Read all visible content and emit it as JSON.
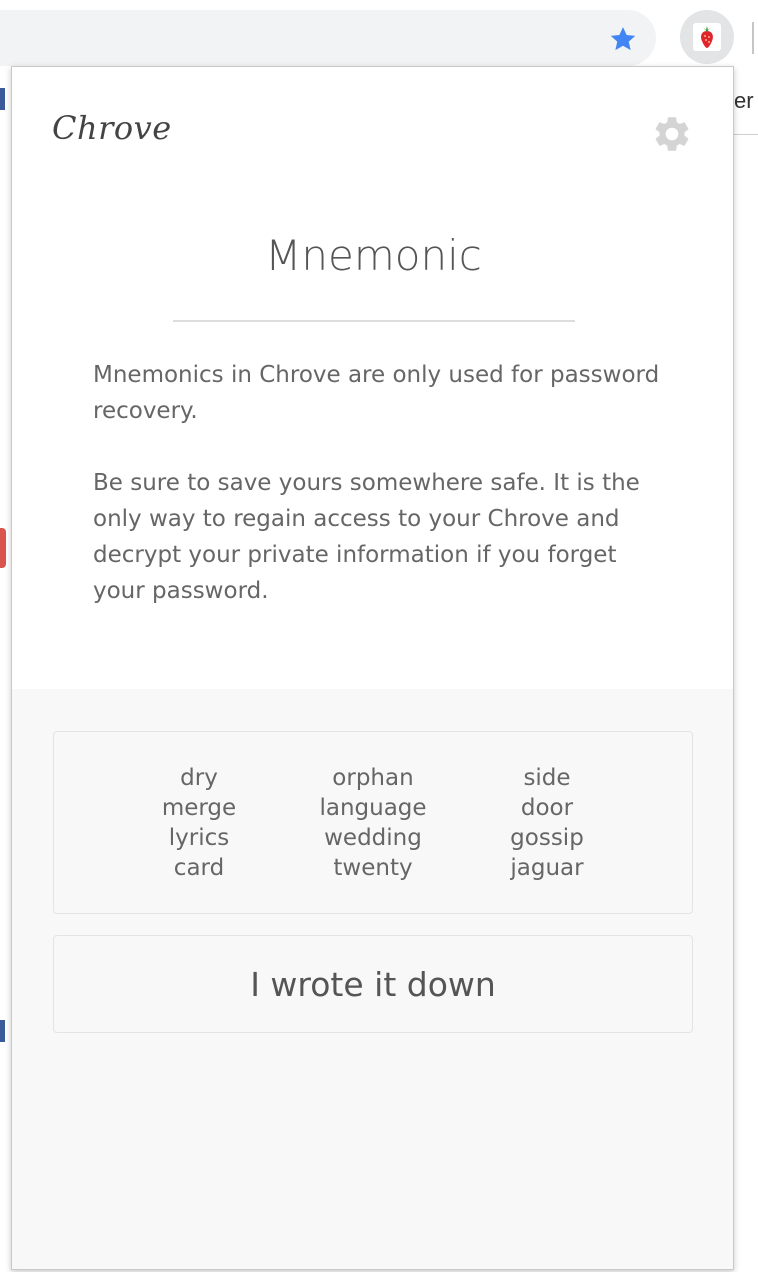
{
  "browser": {
    "bookmark_star_color": "#4285f4",
    "partial_page_text": "er b",
    "extension_icon": "strawberry-icon"
  },
  "popup": {
    "brand": "Chrove",
    "settings_icon": "gear-icon",
    "title": "Mnemonic",
    "description": [
      "Mnemonics in Chrove are only used for password recovery.",
      "Be sure to save yours somewhere safe. It is the only way to regain access to your Chrove and decrypt your private information if you forget your password."
    ],
    "mnemonic_columns": [
      [
        "dry",
        "merge",
        "lyrics",
        "card"
      ],
      [
        "orphan",
        "language",
        "wedding",
        "twenty"
      ],
      [
        "side",
        "door",
        "gossip",
        "jaguar"
      ]
    ],
    "confirm_button": "I wrote it down"
  }
}
